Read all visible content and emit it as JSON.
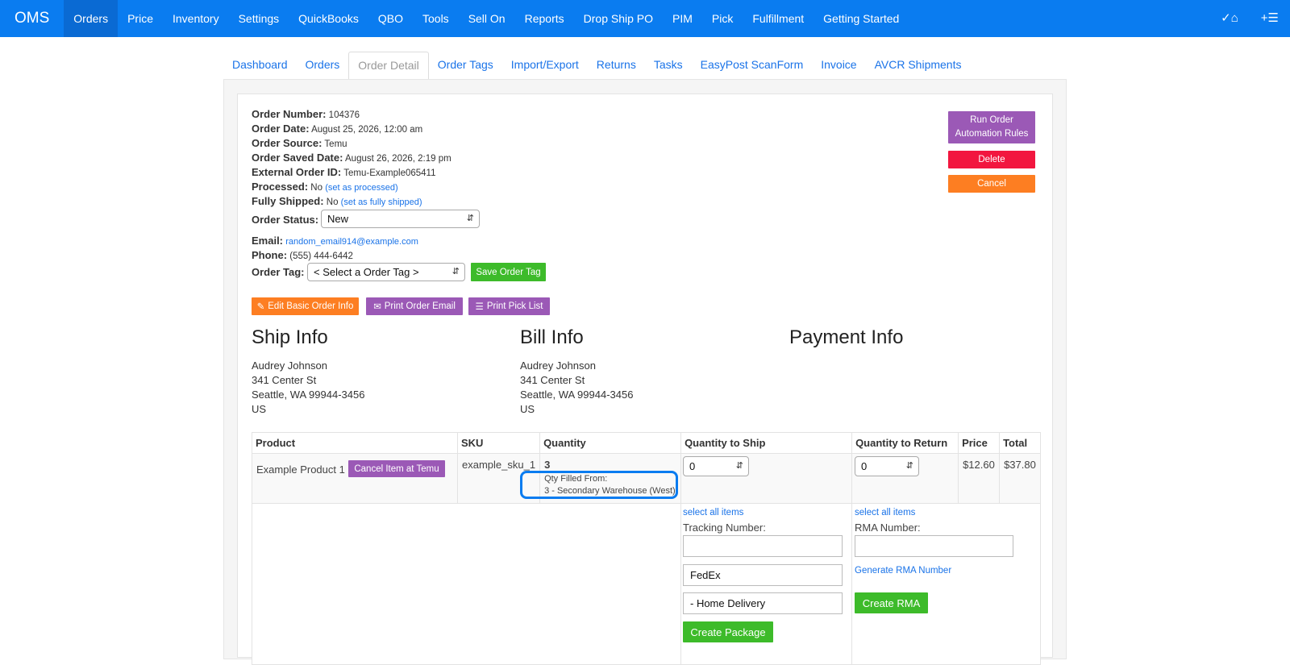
{
  "nav": {
    "brand": "OMS",
    "items": [
      "Orders",
      "Price",
      "Inventory",
      "Settings",
      "QuickBooks",
      "QBO",
      "Tools",
      "Sell On",
      "Reports",
      "Drop Ship PO",
      "PIM",
      "Pick",
      "Fulfillment",
      "Getting Started"
    ],
    "active": "Orders",
    "right_icons": [
      "check-home-icon",
      "add-list-icon"
    ]
  },
  "tabs": [
    "Dashboard",
    "Orders",
    "Order Detail",
    "Order Tags",
    "Import/Export",
    "Returns",
    "Tasks",
    "EasyPost ScanForm",
    "Invoice",
    "AVCR Shipments"
  ],
  "active_tab": "Order Detail",
  "order": {
    "number_label": "Order Number:",
    "number": "104376",
    "date_label": "Order Date:",
    "date": "August 25, 2026, 12:00 am",
    "source_label": "Order Source:",
    "source": "Temu",
    "saved_label": "Order Saved Date:",
    "saved": "August 26, 2026, 2:19 pm",
    "external_label": "External Order ID:",
    "external": "Temu-Example065411",
    "processed_label": "Processed:",
    "processed": "No",
    "processed_link": "(set as processed)",
    "shipped_label": "Fully Shipped:",
    "shipped": "No",
    "shipped_link": "(set as fully shipped)",
    "status_label": "Order Status:",
    "status": "New",
    "email_label": "Email:",
    "email": "random_email914@example.com",
    "phone_label": "Phone:",
    "phone": "(555) 444-6442",
    "tag_label": "Order Tag:",
    "tag_placeholder": "< Select a Order Tag >"
  },
  "buttons": {
    "run_rules_1": "Run Order",
    "run_rules_2": "Automation Rules",
    "delete": "Delete",
    "cancel": "Cancel",
    "save_tag": "Save Order Tag",
    "edit_basic": "Edit Basic Order Info",
    "print_email": "Print Order Email",
    "print_pick": "Print Pick List"
  },
  "sections": {
    "ship": "Ship Info",
    "bill": "Bill Info",
    "payment": "Payment Info"
  },
  "ship": [
    "Audrey Johnson",
    "341 Center St",
    "Seattle, WA 99944-3456",
    "US"
  ],
  "bill": [
    "Audrey Johnson",
    "341 Center St",
    "Seattle, WA 99944-3456",
    "US"
  ],
  "table": {
    "headers": [
      "Product",
      "SKU",
      "Quantity",
      "Quantity to Ship",
      "Quantity to Return",
      "Price",
      "Total"
    ],
    "row": {
      "product": "Example Product 1",
      "cancel_btn": "Cancel Item at Temu",
      "sku": "example_sku_1",
      "qty": "3",
      "filled_label": "Qty Filled From:",
      "filled_value": "3 - Secondary Warehouse (West)",
      "qty_ship": "0",
      "qty_return": "0",
      "price": "$12.60",
      "total": "$37.80"
    }
  },
  "ship_form": {
    "select_all": "select all items",
    "tracking_label": "Tracking Number:",
    "tracking_value": "",
    "carrier": "FedEx",
    "service": "- Home Delivery",
    "create_package": "Create Package"
  },
  "return_form": {
    "select_all": "select all items",
    "rma_label": "RMA Number:",
    "rma_value": "",
    "generate": "Generate RMA Number",
    "create_rma": "Create RMA"
  },
  "colors": {
    "nav": "#0a7cf0",
    "purple": "#9b59b6",
    "red": "#f2163f",
    "orange": "#fd7e22",
    "green": "#3dbb2a"
  }
}
